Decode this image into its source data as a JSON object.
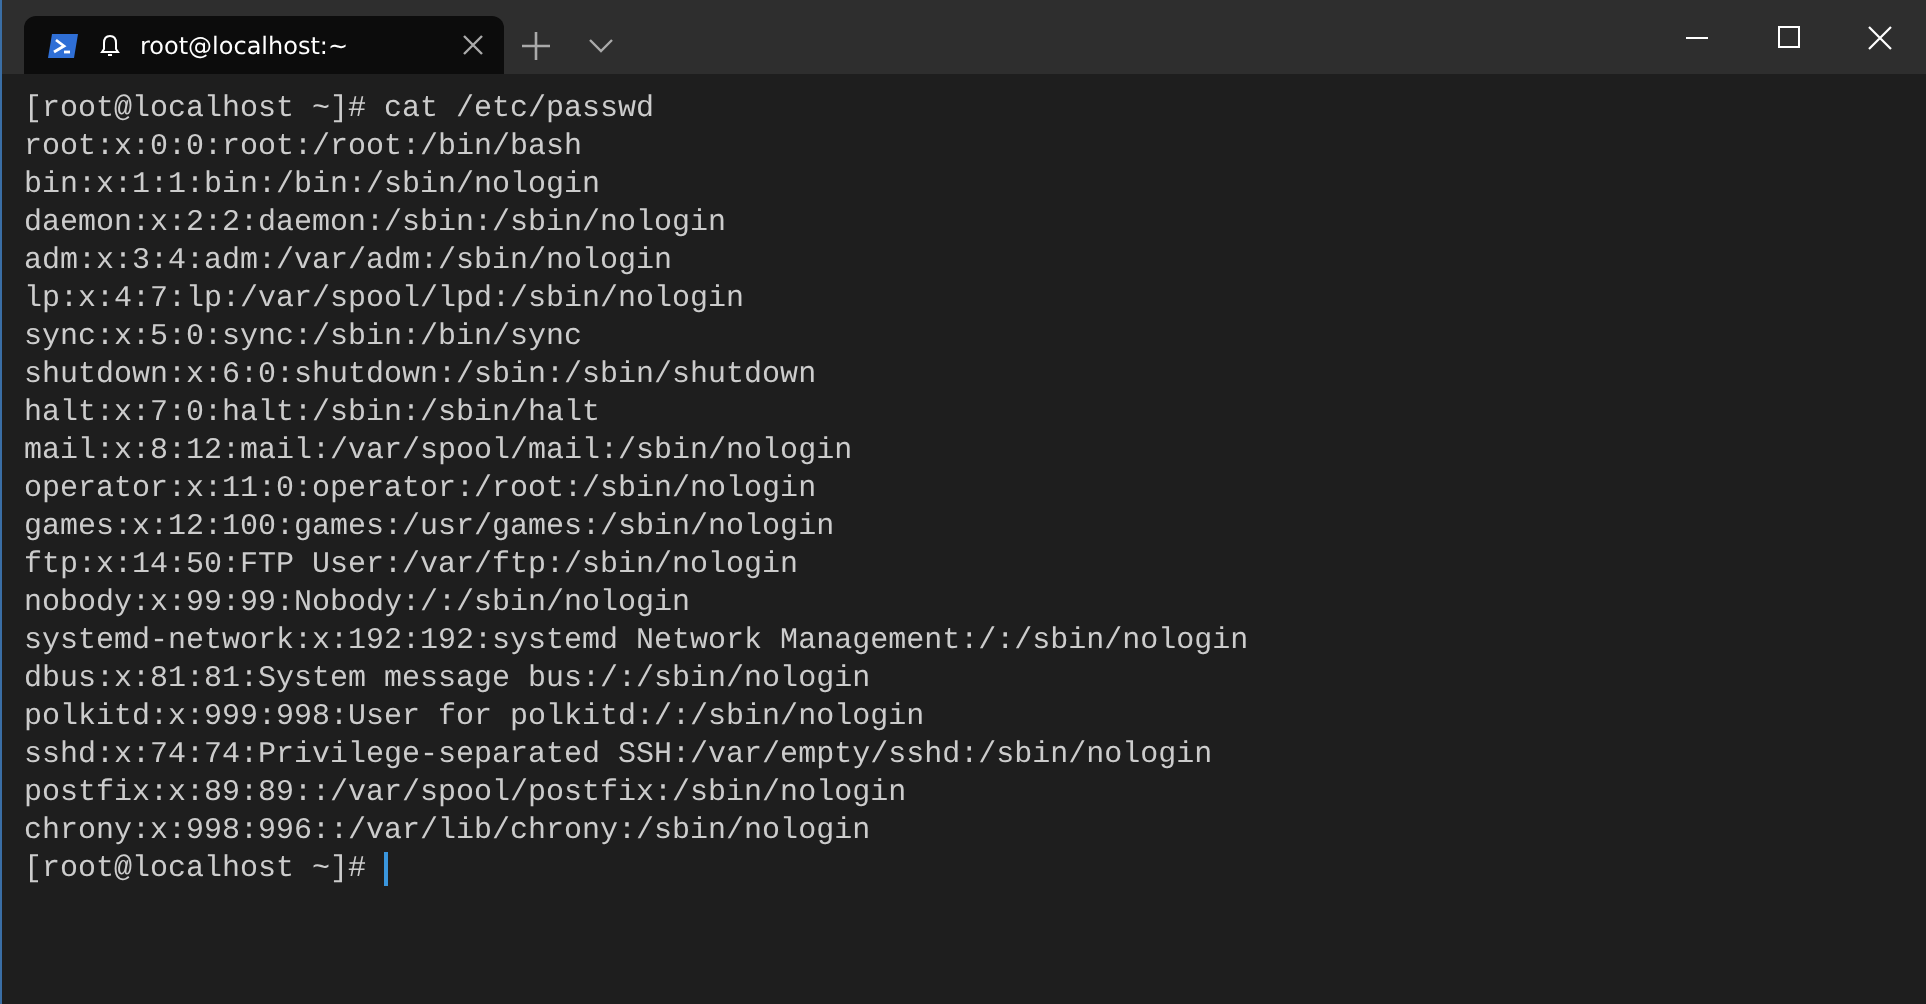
{
  "tabs": [
    {
      "title": "root@localhost:~",
      "selected": true
    }
  ],
  "terminal": {
    "lines": [
      "[root@localhost ~]# cat /etc/passwd",
      "root:x:0:0:root:/root:/bin/bash",
      "bin:x:1:1:bin:/bin:/sbin/nologin",
      "daemon:x:2:2:daemon:/sbin:/sbin/nologin",
      "adm:x:3:4:adm:/var/adm:/sbin/nologin",
      "lp:x:4:7:lp:/var/spool/lpd:/sbin/nologin",
      "sync:x:5:0:sync:/sbin:/bin/sync",
      "shutdown:x:6:0:shutdown:/sbin:/sbin/shutdown",
      "halt:x:7:0:halt:/sbin:/sbin/halt",
      "mail:x:8:12:mail:/var/spool/mail:/sbin/nologin",
      "operator:x:11:0:operator:/root:/sbin/nologin",
      "games:x:12:100:games:/usr/games:/sbin/nologin",
      "ftp:x:14:50:FTP User:/var/ftp:/sbin/nologin",
      "nobody:x:99:99:Nobody:/:/sbin/nologin",
      "systemd-network:x:192:192:systemd Network Management:/:/sbin/nologin",
      "dbus:x:81:81:System message bus:/:/sbin/nologin",
      "polkitd:x:999:998:User for polkitd:/:/sbin/nologin",
      "sshd:x:74:74:Privilege-separated SSH:/var/empty/sshd:/sbin/nologin",
      "postfix:x:89:89::/var/spool/postfix:/sbin/nologin",
      "chrony:x:998:996::/var/lib/chrony:/sbin/nologin"
    ],
    "prompt": "[root@localhost ~]#"
  }
}
